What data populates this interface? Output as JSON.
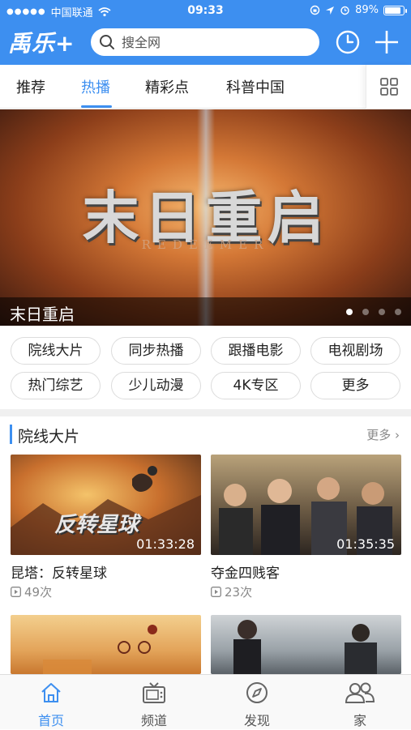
{
  "status_bar": {
    "carrier": "中国联通",
    "time": "09:33",
    "battery": "89%",
    "battery_level": 0.89
  },
  "header": {
    "logo": "禹乐+",
    "search_placeholder": "搜全网",
    "history_icon": "clock-icon",
    "add_icon": "plus-icon"
  },
  "tabs": {
    "items": [
      {
        "label": "推荐"
      },
      {
        "label": "热播"
      },
      {
        "label": "精彩点"
      },
      {
        "label": "科普中国"
      }
    ],
    "active_index": 1,
    "grid_icon": "grid-icon"
  },
  "banner": {
    "art_title": "末日重启",
    "art_subtitle": "REDEEMER",
    "caption": "末日重启",
    "pages": 4,
    "current_page": 1
  },
  "categories": [
    {
      "label": "院线大片"
    },
    {
      "label": "同步热播"
    },
    {
      "label": "跟播电影"
    },
    {
      "label": "电视剧场"
    },
    {
      "label": "热门综艺"
    },
    {
      "label": "少儿动漫"
    },
    {
      "label": "4K专区"
    },
    {
      "label": "更多"
    }
  ],
  "section": {
    "title": "院线大片",
    "more": "更多 ›"
  },
  "videos": [
    {
      "title": "昆塔：反转星球",
      "plays": "49次",
      "duration": "01:33:28",
      "thumb_text": "反转星球"
    },
    {
      "title": "夺金四贱客",
      "plays": "23次",
      "duration": "01:35:35"
    },
    {
      "title": "",
      "plays": "",
      "duration": ""
    },
    {
      "title": "",
      "plays": "",
      "duration": ""
    }
  ],
  "bottom_nav": {
    "items": [
      {
        "label": "首页",
        "icon": "home-icon"
      },
      {
        "label": "频道",
        "icon": "tv-icon"
      },
      {
        "label": "发现",
        "icon": "compass-icon"
      },
      {
        "label": "家",
        "icon": "family-icon"
      }
    ],
    "active_index": 0
  },
  "colors": {
    "accent": "#3d8ff0",
    "text": "#222222",
    "muted": "#888888"
  }
}
